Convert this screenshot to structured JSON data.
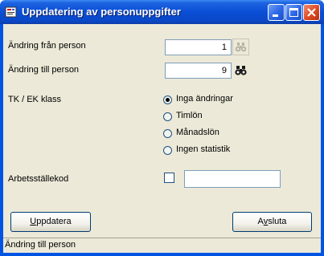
{
  "window": {
    "title": "Uppdatering av personuppgifter",
    "minimize_label": "Minimize",
    "maximize_label": "Maximize",
    "close_label": "Close"
  },
  "form": {
    "from_person_label": "Ändring från person",
    "from_person_value": "1",
    "to_person_label": "Ändring till person",
    "to_person_value": "9",
    "tk_ek_label": "TK / EK klass",
    "tk_ek_options": [
      {
        "label": "Inga ändringar",
        "selected": true
      },
      {
        "label": "Timlön",
        "selected": false
      },
      {
        "label": "Månadslön",
        "selected": false
      },
      {
        "label": "Ingen statistik",
        "selected": false
      }
    ],
    "workplace_code_label": "Arbetsställekod",
    "workplace_code_checked": false,
    "workplace_code_value": ""
  },
  "buttons": {
    "update_label_first": "U",
    "update_label_rest": "ppdatera",
    "quit_label_first": "A",
    "quit_label_underlined": "v",
    "quit_label_rest": "sluta"
  },
  "status_bar": {
    "text": "Ändring till person"
  },
  "icons": {
    "app": "form-icon",
    "lookup": "binoculars-icon"
  }
}
